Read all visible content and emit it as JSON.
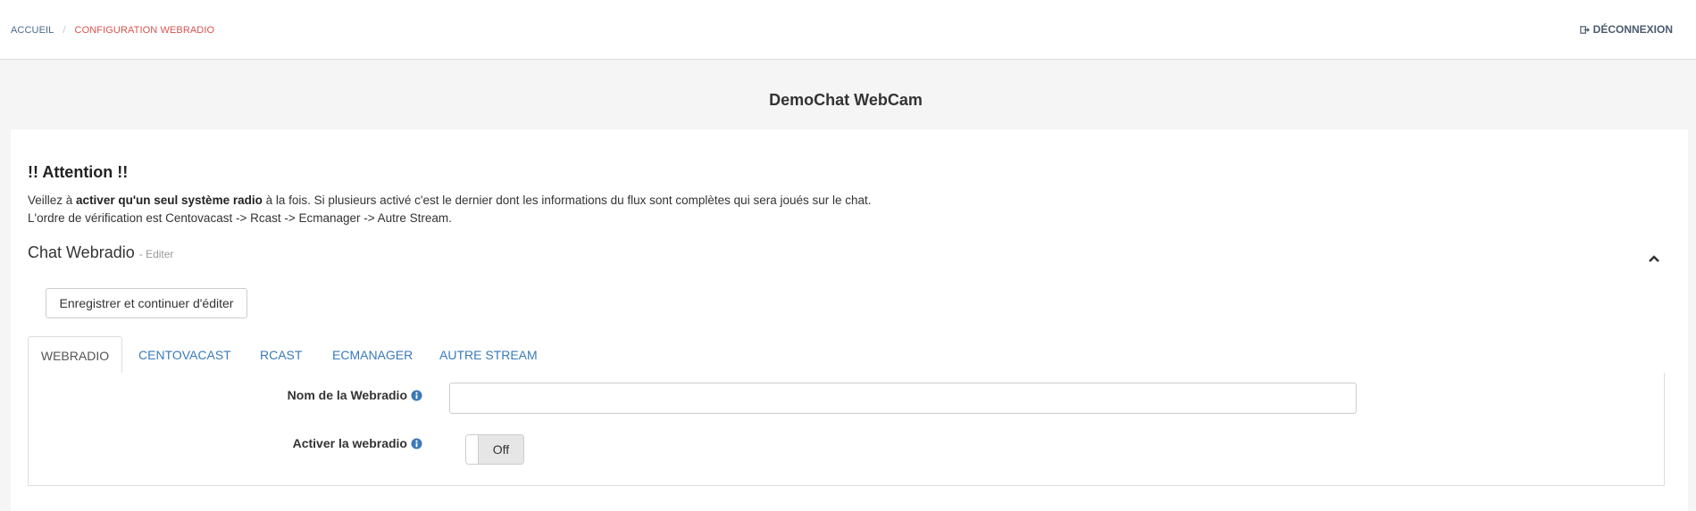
{
  "breadcrumb": {
    "home": "ACCUEIL",
    "separator": "/",
    "current": "CONFIGURATION WEBRADIO"
  },
  "header": {
    "logout_label": "DÉCONNEXION",
    "logout_icon": "logout-icon"
  },
  "page_title": "DemoChat WebCam",
  "attention": {
    "title": "!! Attention !!",
    "line1_prefix": "Veillez à ",
    "line1_bold": "activer qu'un seul système radio",
    "line1_suffix": " à la fois. Si plusieurs activé c'est le dernier dont les informations du flux sont complètes qui sera joués sur le chat.",
    "line2": "L'ordre de vérification est Centovacast -> Rcast -> Ecmanager -> Autre Stream."
  },
  "section": {
    "title": "Chat Webradio",
    "subtitle": "- Editer",
    "collapse_icon": "chevron-up-icon"
  },
  "actions": {
    "save_continue_label": "Enregistrer et continuer d'éditer"
  },
  "tabs": [
    {
      "label": "WEBRADIO",
      "active": true
    },
    {
      "label": "CENTOVACAST",
      "active": false
    },
    {
      "label": "RCAST",
      "active": false
    },
    {
      "label": "ECMANAGER",
      "active": false
    },
    {
      "label": "AUTRE STREAM",
      "active": false
    }
  ],
  "form": {
    "name_label": "Nom de la Webradio",
    "name_value": "",
    "activate_label": "Activer la webradio",
    "activate_state": "Off",
    "info_icon": "info-icon"
  },
  "colors": {
    "link": "#3a7ab8",
    "breadcrumb_current": "#d9534f",
    "info_icon": "#3a7ab8"
  }
}
